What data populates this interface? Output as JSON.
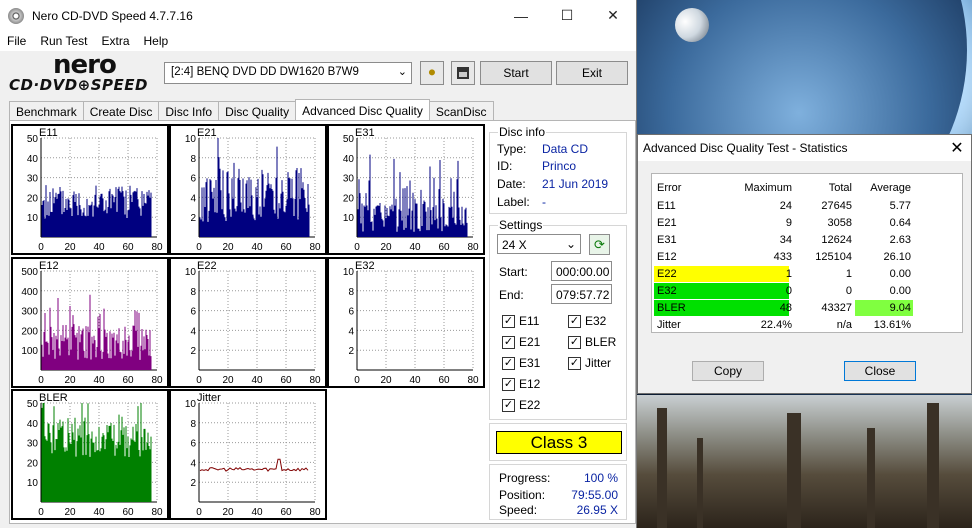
{
  "window": {
    "title": "Nero CD-DVD Speed 4.7.7.16",
    "controls": {
      "minimize": "—",
      "maximize": "☐",
      "close": "✕"
    }
  },
  "menu": [
    "File",
    "Run Test",
    "Extra",
    "Help"
  ],
  "logo": {
    "brand": "nero",
    "product": "CD·DVD⊕SPEED"
  },
  "toolbar": {
    "drive": "[2:4]   BENQ DVD DD DW1620 B7W9",
    "start_label": "Start",
    "exit_label": "Exit",
    "icons": [
      "eject-icon",
      "save-icon"
    ]
  },
  "tabs": [
    "Benchmark",
    "Create Disc",
    "Disc Info",
    "Disc Quality",
    "Advanced Disc Quality",
    "ScanDisc"
  ],
  "active_tab": "Advanced Disc Quality",
  "disc_info": {
    "heading": "Disc info",
    "type_label": "Type:",
    "type": "Data CD",
    "id_label": "ID:",
    "id": "Princo",
    "date_label": "Date:",
    "date": "21 Jun 2019",
    "label_label": "Label:",
    "label": "-"
  },
  "settings": {
    "heading": "Settings",
    "speed": "24 X",
    "start_label": "Start:",
    "start": "000:00.00",
    "end_label": "End:",
    "end": "079:57.72",
    "checks": [
      {
        "label": "E11",
        "checked": true
      },
      {
        "label": "E32",
        "checked": true
      },
      {
        "label": "E21",
        "checked": true
      },
      {
        "label": "BLER",
        "checked": true
      },
      {
        "label": "E31",
        "checked": true
      },
      {
        "label": "Jitter",
        "checked": true
      },
      {
        "label": "E12",
        "checked": true
      },
      {
        "label": "E22",
        "checked": true
      }
    ]
  },
  "class_label": "Class 3",
  "progress": {
    "progress_label": "Progress:",
    "progress": "100 %",
    "position_label": "Position:",
    "position": "79:55.00",
    "speed_label": "Speed:",
    "speed": "26.95 X"
  },
  "chart_data": [
    {
      "type": "bar",
      "title": "E11",
      "ylim": [
        0,
        50
      ],
      "yticks": [
        "50",
        "40",
        "30",
        "20",
        "10"
      ],
      "xticks": [
        "0",
        "20",
        "40",
        "60",
        "80"
      ],
      "color": "#000080"
    },
    {
      "type": "bar",
      "title": "E21",
      "ylim": [
        0,
        10
      ],
      "yticks": [
        "10",
        "8",
        "6",
        "4",
        "2"
      ],
      "xticks": [
        "0",
        "20",
        "40",
        "60",
        "80"
      ],
      "color": "#000080"
    },
    {
      "type": "bar",
      "title": "E31",
      "ylim": [
        0,
        50
      ],
      "yticks": [
        "50",
        "40",
        "30",
        "20",
        "10"
      ],
      "xticks": [
        "0",
        "20",
        "40",
        "60",
        "80"
      ],
      "color": "#000080"
    },
    {
      "type": "bar",
      "title": "E12",
      "ylim": [
        0,
        500
      ],
      "yticks": [
        "500",
        "400",
        "300",
        "200",
        "100"
      ],
      "xticks": [
        "0",
        "20",
        "40",
        "60",
        "80"
      ],
      "color": "#800080"
    },
    {
      "type": "bar",
      "title": "E22",
      "ylim": [
        0,
        10
      ],
      "yticks": [
        "10",
        "8",
        "6",
        "4",
        "2"
      ],
      "xticks": [
        "0",
        "20",
        "40",
        "60",
        "80"
      ],
      "color": "#800080"
    },
    {
      "type": "bar",
      "title": "E32",
      "ylim": [
        0,
        10
      ],
      "yticks": [
        "10",
        "8",
        "6",
        "4",
        "2"
      ],
      "xticks": [
        "0",
        "20",
        "40",
        "60",
        "80"
      ],
      "color": "#800080"
    },
    {
      "type": "bar",
      "title": "BLER",
      "ylim": [
        0,
        50
      ],
      "yticks": [
        "50",
        "40",
        "30",
        "20",
        "10"
      ],
      "xticks": [
        "0",
        "20",
        "40",
        "60",
        "80"
      ],
      "color": "#008000"
    },
    {
      "type": "line",
      "title": "Jitter",
      "ylim": [
        0,
        10
      ],
      "yticks": [
        "10",
        "8",
        "6",
        "4",
        "2"
      ],
      "xticks": [
        "0",
        "20",
        "40",
        "60",
        "80"
      ],
      "color": "#800000"
    }
  ],
  "stats": {
    "title": "Advanced Disc Quality Test - Statistics",
    "headers": [
      "Error",
      "Maximum",
      "Total",
      "Average"
    ],
    "rows": [
      [
        "E11",
        "24",
        "27645",
        "5.77"
      ],
      [
        "E21",
        "9",
        "3058",
        "0.64"
      ],
      [
        "E31",
        "34",
        "12624",
        "2.63"
      ],
      [
        "E12",
        "433",
        "125104",
        "26.10"
      ],
      [
        "E22",
        "1",
        "1",
        "0.00"
      ],
      [
        "E32",
        "0",
        "0",
        "0.00"
      ],
      [
        "BLER",
        "48",
        "43327",
        "9.04"
      ],
      [
        "Jitter",
        "22.4%",
        "n/a",
        "13.61%"
      ]
    ],
    "copy_label": "Copy",
    "close_label": "Close",
    "highlight_colors": {
      "yellow": "#ffff00",
      "green": "#00e000",
      "lime": "#80ff40"
    }
  }
}
